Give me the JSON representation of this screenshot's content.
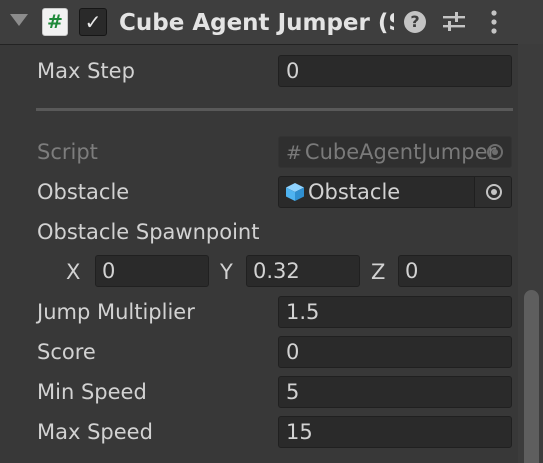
{
  "component": {
    "title": "Cube Agent Jumper (Script)",
    "enabled": true,
    "help_glyph": "?",
    "script_glyph": "#",
    "checkbox_glyph": "✓"
  },
  "fields": {
    "max_step": {
      "label": "Max Step",
      "value": "0"
    },
    "script": {
      "label": "Script",
      "glyph": "#",
      "value": "CubeAgentJumper"
    },
    "obstacle": {
      "label": "Obstacle",
      "value": "Obstacle"
    },
    "obstacle_spawnpoint": {
      "label": "Obstacle Spawnpoint",
      "x_label": "X",
      "x": "0",
      "y_label": "Y",
      "y": "0.32",
      "z_label": "Z",
      "z": "0"
    },
    "jump_multiplier": {
      "label": "Jump Multiplier",
      "value": "1.5"
    },
    "score": {
      "label": "Score",
      "value": "0"
    },
    "min_speed": {
      "label": "Min Speed",
      "value": "5"
    },
    "max_speed": {
      "label": "Max Speed",
      "value": "15"
    }
  },
  "icons": {
    "foldout": "foldout-arrow-icon",
    "script": "csharp-script-icon",
    "help": "help-icon",
    "presets": "presets-icon",
    "menu": "kebab-menu-icon",
    "object_picker": "object-picker-icon",
    "prefab": "prefab-cube-icon"
  },
  "colors": {
    "background": "#383838",
    "header": "#3e3e3e",
    "field": "#2a2a2a",
    "text": "#d2d2d2",
    "dim_text": "#7d7d7d",
    "prefab_cube": "#4fb3f0"
  }
}
